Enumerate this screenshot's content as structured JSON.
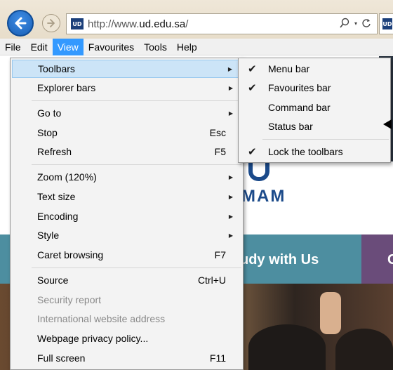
{
  "browser": {
    "url_prefix": "http://www.",
    "url_domain": "ud.edu.sa",
    "url_suffix": "/",
    "favicon_text": "UD",
    "search_icon": "search-icon",
    "refresh_icon": "refresh-icon"
  },
  "menubar": [
    "File",
    "Edit",
    "View",
    "Favourites",
    "Tools",
    "Help"
  ],
  "view_menu": {
    "items": [
      {
        "label": "Toolbars",
        "submenu": true
      },
      {
        "label": "Explorer bars",
        "submenu": true
      },
      {
        "label": "Go to",
        "submenu": true
      },
      {
        "label": "Stop",
        "shortcut": "Esc"
      },
      {
        "label": "Refresh",
        "shortcut": "F5"
      },
      {
        "label": "Zoom (120%)",
        "submenu": true
      },
      {
        "label": "Text size",
        "submenu": true
      },
      {
        "label": "Encoding",
        "submenu": true
      },
      {
        "label": "Style",
        "submenu": true
      },
      {
        "label": "Caret browsing",
        "shortcut": "F7"
      },
      {
        "label": "Source",
        "shortcut": "Ctrl+U"
      },
      {
        "label": "Security report",
        "disabled": true
      },
      {
        "label": "International website address",
        "disabled": true
      },
      {
        "label": "Webpage privacy policy..."
      },
      {
        "label": "Full screen",
        "shortcut": "F11"
      }
    ]
  },
  "toolbars_submenu": {
    "items": [
      {
        "label": "Menu bar",
        "checked": true
      },
      {
        "label": "Favourites bar",
        "checked": true
      },
      {
        "label": "Command bar",
        "checked": false
      },
      {
        "label": "Status bar",
        "checked": false
      },
      {
        "label": "Lock the toolbars",
        "checked": true
      }
    ]
  },
  "page": {
    "logo_text": "MAM",
    "band_text": "udy with Us",
    "band_text_2": "C"
  },
  "colors": {
    "menu_highlight": "#3399ff",
    "row_highlight": "#cce4f7",
    "teal_band": "#4d8ea0",
    "purple_band": "#6a4c7a"
  }
}
